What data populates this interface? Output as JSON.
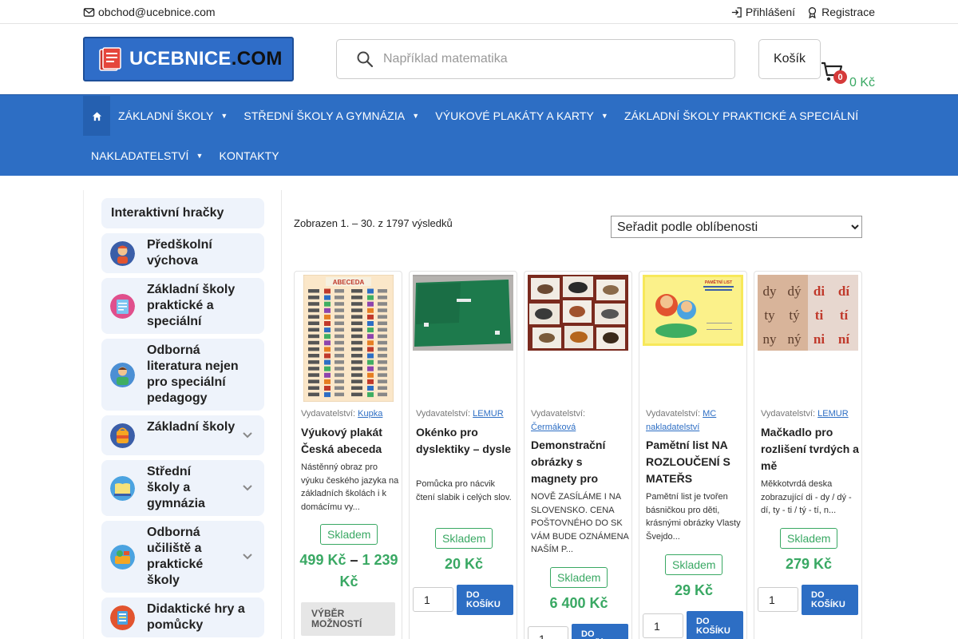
{
  "topbar": {
    "email": "obchod@ucebnice.com",
    "login_label": "Přihlášení",
    "register_label": "Registrace"
  },
  "header": {
    "logo_text_main": "UCEBNICE",
    "logo_text_domain": ".COM",
    "search_placeholder": "Například matematika",
    "search_value": "",
    "cart_label": "Košík",
    "cart_count": "0",
    "cart_total": "0 Kč"
  },
  "colors": {
    "brand_blue": "#2d6ec4",
    "price_green": "#39a863",
    "badge_red": "#d53a3a",
    "sidebar_bg": "#eef3fb"
  },
  "nav": {
    "home_icon": "home-icon",
    "row1": [
      {
        "label": "ZÁKLADNÍ ŠKOLY",
        "has_submenu": true
      },
      {
        "label": "STŘEDNÍ ŠKOLY A GYMNÁZIA",
        "has_submenu": true
      },
      {
        "label": "VÝUKOVÉ PLAKÁTY A KARTY",
        "has_submenu": true
      },
      {
        "label": "ZÁKLADNÍ ŠKOLY PRAKTICKÉ A SPECIÁLNÍ",
        "has_submenu": false
      }
    ],
    "row2": [
      {
        "label": "NAKLADATELSTVÍ",
        "has_submenu": true
      },
      {
        "label": "KONTAKTY",
        "has_submenu": false
      }
    ]
  },
  "sidebar": {
    "title": "Interaktivní hračky",
    "items": [
      {
        "label": "Předškolní výchova",
        "icon": "preschool-child-icon",
        "expandable": false
      },
      {
        "label": "Základní školy praktické a speciální",
        "icon": "notebook-icon",
        "expandable": false
      },
      {
        "label": "Odborná literatura nejen pro speciální pedagogy",
        "icon": "teacher-icon",
        "expandable": false
      },
      {
        "label": "Základní školy",
        "icon": "schoolbag-icon",
        "expandable": true
      },
      {
        "label": "Střední školy a gymnázia",
        "icon": "open-book-icon",
        "expandable": true
      },
      {
        "label": "Odborná učiliště a praktické školy",
        "icon": "tools-icon",
        "expandable": true
      },
      {
        "label": "Didaktické hry a pomůcky",
        "icon": "learning-cards-icon",
        "expandable": false
      }
    ]
  },
  "results": {
    "count_text": "Zobrazen 1. – 30. z 1797 výsledků",
    "sort_selected": "Seřadit podle oblíbenosti"
  },
  "products": [
    {
      "publisher_label": "Vydavatelství:",
      "publisher": "Kupka",
      "title": "Výukový plakát Česká abeceda",
      "description": "Nástěnný obraz pro výuku českého jazyka na základních školách i k domácímu vy...",
      "stock": "Skladem",
      "price": "499 Kč",
      "price_dash": "–",
      "price_max": "1 239 Kč",
      "button": "Výběr možností",
      "poster_heading": "ABECEDA",
      "image": "alphabet-poster"
    },
    {
      "publisher_label": "Vydavatelství:",
      "publisher": "LEMUR",
      "title": "Okénko pro dyslektiky – dysle",
      "description": "Pomůcka pro nácvik čtení slabik i celých slov.",
      "stock": "Skladem",
      "price": "20 Kč",
      "qty": "1",
      "button": "Do košíku",
      "image": "green-reading-window"
    },
    {
      "publisher_label": "Vydavatelství:",
      "publisher": "Čermáková",
      "title": "Demonstrační obrázky s magnety pro",
      "description": "NOVĚ ZASÍLÁME I NA SLOVENSKO. CENA POŠTOVNÉHO DO SK VÁM BUDE OZNÁMENA NAŠÍM P...",
      "stock": "Skladem",
      "price": "6 400 Kč",
      "qty": "1",
      "button": "Do košíku",
      "image": "animal-magnet-cards"
    },
    {
      "publisher_label": "Vydavatelství:",
      "publisher": "MC nakladatelství",
      "title": "Pamětní list NA ROZLOUČENÍ S MATEŘS",
      "description": "Pamětní list je tvořen básničkou pro děti, krásnými obrázky Vlasty Švejdo...",
      "stock": "Skladem",
      "price": "29 Kč",
      "qty": "1",
      "button": "Do košíku",
      "certificate_heading": "PAMĚTNÍ LIST",
      "image": "kindergarten-farewell-certificate"
    },
    {
      "publisher_label": "Vydavatelství:",
      "publisher": "LEMUR",
      "title": "Mačkadlo pro rozlišení tvrdých a mě",
      "description": "Měkkotvrdá deska zobrazující di - dy / dý - dí, ty - ti / tý - tí, n...",
      "stock": "Skladem",
      "price": "279 Kč",
      "qty": "1",
      "button": "Do košíku",
      "image": "syllable-board",
      "syllables": [
        "dy",
        "dý",
        "di",
        "dí",
        "ty",
        "tý",
        "ti",
        "tí",
        "ny",
        "ný",
        "ni",
        "ní"
      ]
    }
  ]
}
